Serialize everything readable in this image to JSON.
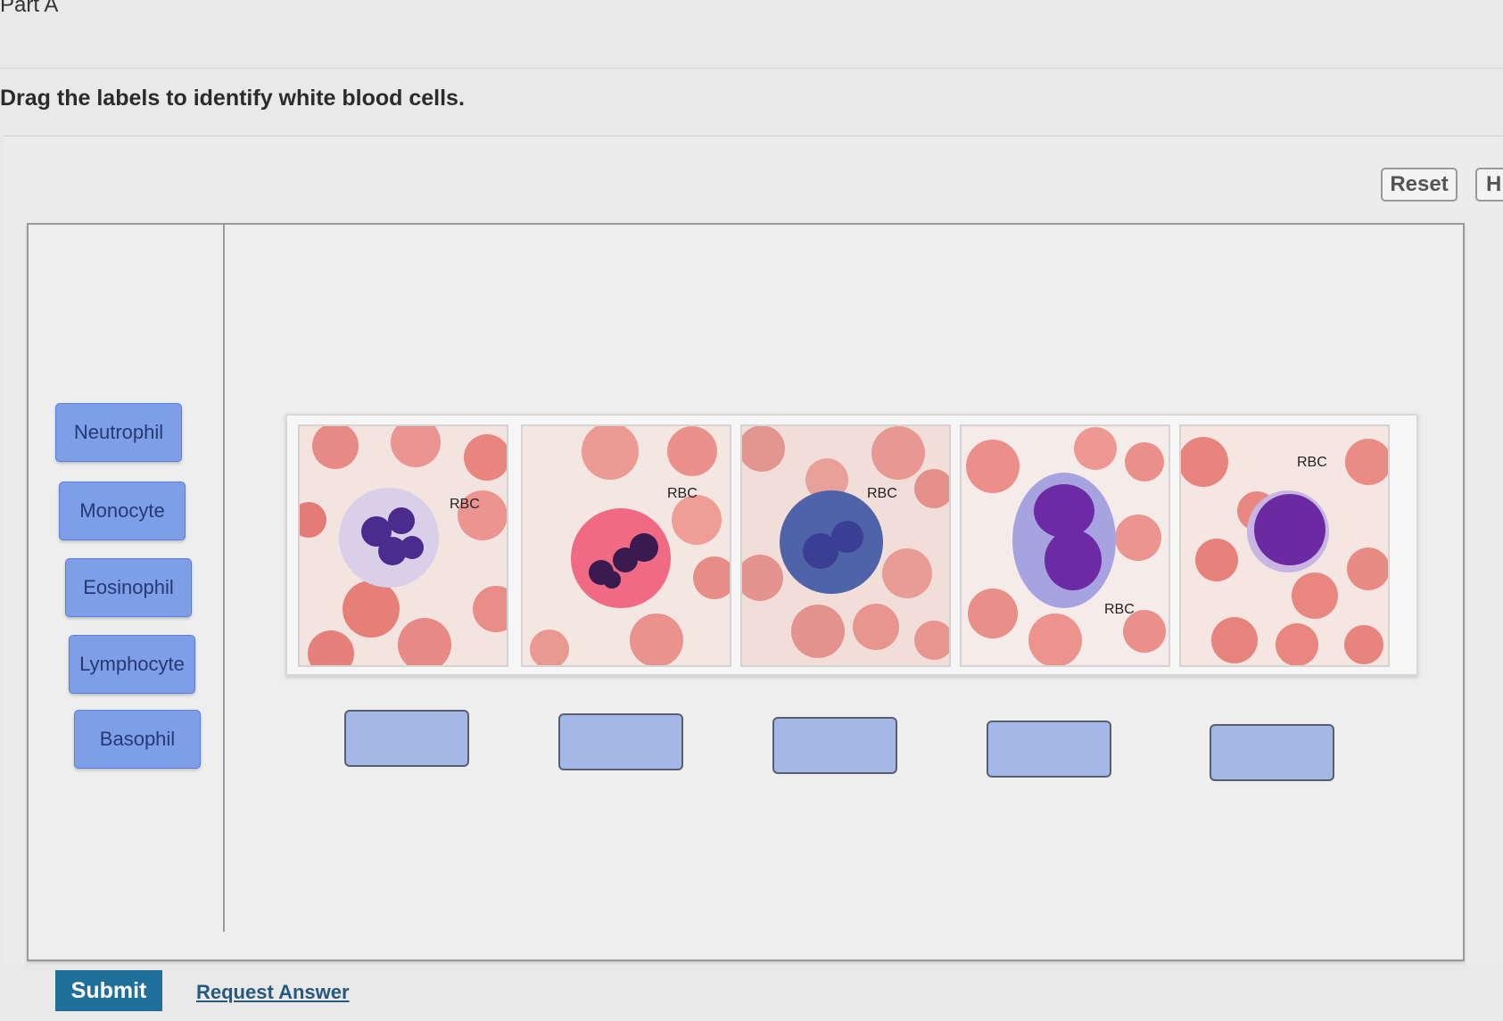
{
  "header": {
    "part_title": "Part A",
    "instructions": "Drag the labels to identify white blood cells."
  },
  "toolbar": {
    "reset_label": "Reset",
    "help_label": "H"
  },
  "labels": [
    "Neutrophil",
    "Monocyte",
    "Eosinophil",
    "Lymphocyte",
    "Basophil"
  ],
  "image": {
    "cell_tags": [
      "RBC",
      "RBC",
      "RBC",
      "RBC",
      "RBC",
      "RBC"
    ]
  },
  "footer": {
    "submit_label": "Submit",
    "request_label": "Request Answer"
  },
  "colors": {
    "label_fill": "#7f9ee8",
    "drop_fill": "#a3b8e6",
    "submit_fill": "#1e6f9a",
    "rbc": "#e77b7b",
    "nucleus": "#4b2a8c"
  }
}
